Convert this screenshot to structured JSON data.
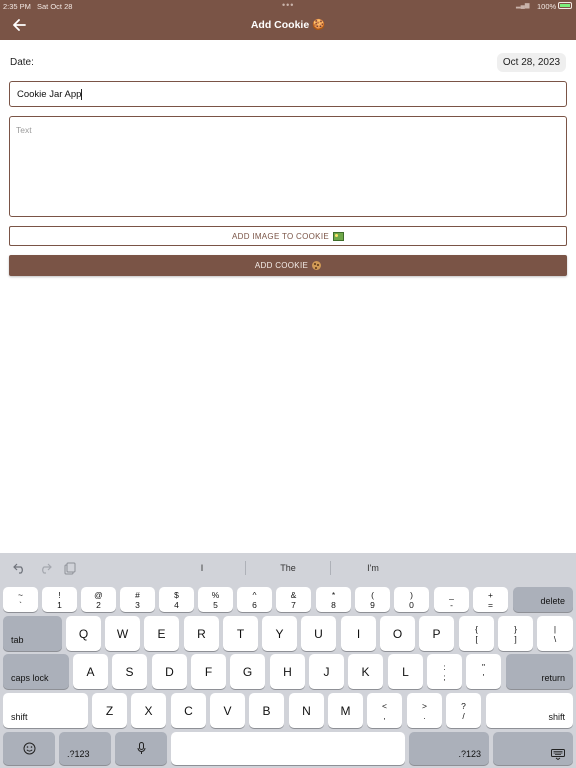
{
  "status_bar": {
    "time": "2:35 PM",
    "date": "Sat Oct 28",
    "battery": "100%"
  },
  "header": {
    "title": "Add Cookie 🍪",
    "back_icon": "arrow-left-icon"
  },
  "form": {
    "date_label": "Date:",
    "date_value": "Oct 28, 2023",
    "title_value": "Cookie Jar App",
    "text_placeholder": "Text",
    "add_image_label": "ADD IMAGE TO COOKIE",
    "add_cookie_label": "ADD COOKIE"
  },
  "colors": {
    "brand": "#7a5446",
    "keyboard_bg": "#d1d3d9",
    "key_dark": "#abb0ba"
  },
  "keyboard": {
    "suggestions": [
      "I",
      "The",
      "I'm"
    ],
    "number_row": [
      {
        "top": "~",
        "bottom": "`"
      },
      {
        "top": "!",
        "bottom": "1"
      },
      {
        "top": "@",
        "bottom": "2"
      },
      {
        "top": "#",
        "bottom": "3"
      },
      {
        "top": "$",
        "bottom": "4"
      },
      {
        "top": "%",
        "bottom": "5"
      },
      {
        "top": "^",
        "bottom": "6"
      },
      {
        "top": "&",
        "bottom": "7"
      },
      {
        "top": "*",
        "bottom": "8"
      },
      {
        "top": "(",
        "bottom": "9"
      },
      {
        "top": ")",
        "bottom": "0"
      },
      {
        "top": "_",
        "bottom": "-"
      },
      {
        "top": "+",
        "bottom": "="
      }
    ],
    "delete": "delete",
    "tab": "tab",
    "row_q": [
      "Q",
      "W",
      "E",
      "R",
      "T",
      "Y",
      "U",
      "I",
      "O",
      "P"
    ],
    "row_q_symbols": [
      {
        "top": "{",
        "bottom": "["
      },
      {
        "top": "}",
        "bottom": "]"
      },
      {
        "top": "|",
        "bottom": "\\"
      }
    ],
    "caps_lock": "caps lock",
    "row_a": [
      "A",
      "S",
      "D",
      "F",
      "G",
      "H",
      "J",
      "K",
      "L"
    ],
    "row_a_symbols": [
      {
        "top": ":",
        "bottom": ";"
      },
      {
        "top": "\"",
        "bottom": "'"
      }
    ],
    "return": "return",
    "shift": "shift",
    "row_z": [
      "Z",
      "X",
      "C",
      "V",
      "B",
      "N",
      "M"
    ],
    "row_z_symbols": [
      {
        "top": "<",
        "bottom": ","
      },
      {
        "top": ">",
        "bottom": "."
      },
      {
        "top": "?",
        "bottom": "/"
      }
    ],
    "numbers_mode": ".?123"
  }
}
